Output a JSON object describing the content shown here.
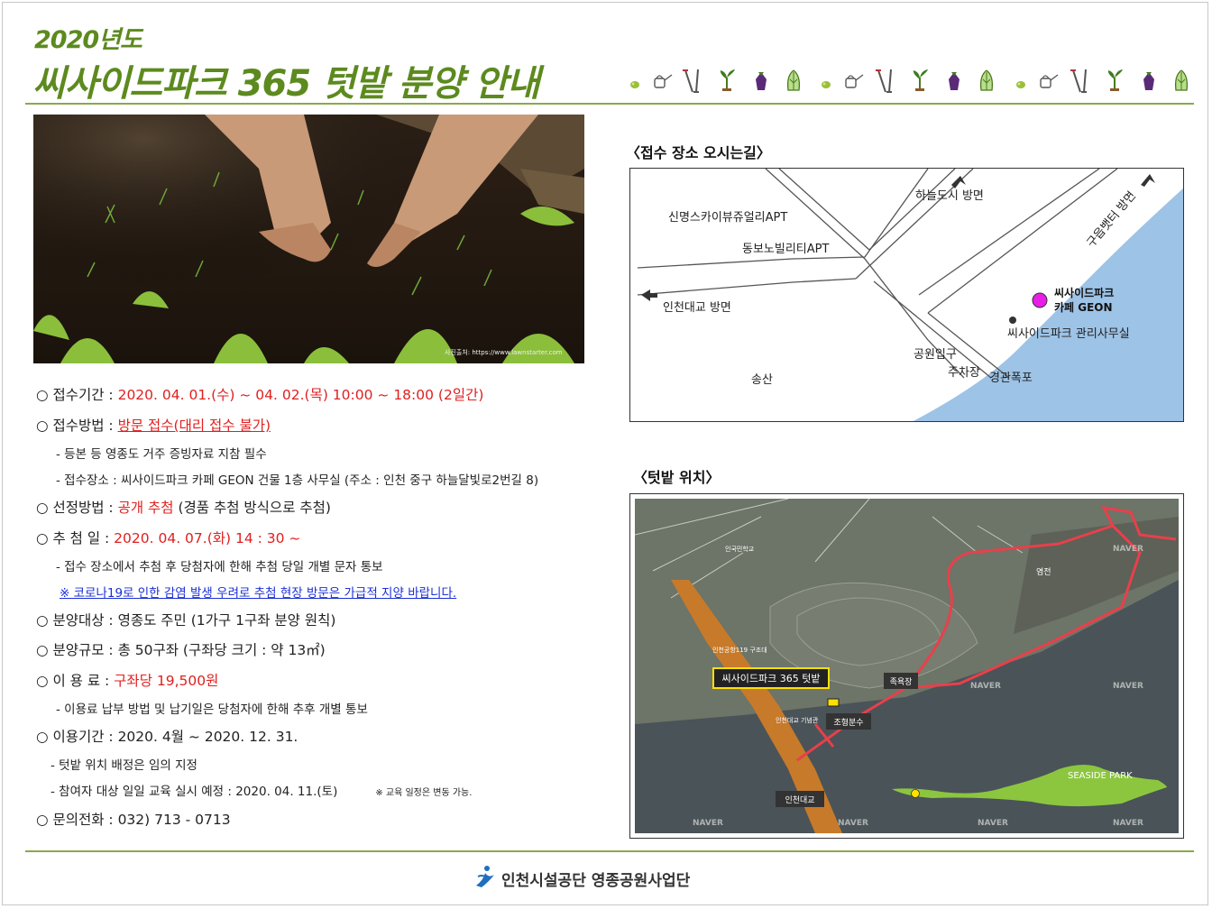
{
  "header": {
    "year": "2020년도",
    "title": "씨사이드파크 365 텃밭 분양 안내"
  },
  "photo": {
    "credit": "사진출처: https://www.lawnstarter.com"
  },
  "icons": [
    "pea-icon",
    "watering-can-icon",
    "garden-tools-icon",
    "seedling-icon",
    "eggplant-icon",
    "cabbage-icon"
  ],
  "info": {
    "period": {
      "label": "○ 접수기간 : ",
      "value": "2020. 04. 01.(수) ~ 04. 02.(목) 10:00 ~ 18:00 (2일간)"
    },
    "method": {
      "label": "○ 접수방법 : ",
      "value": "방문 접수(대리 접수 불가)"
    },
    "method_sub1": "- 등본 등 영종도 거주 증빙자료 지참 필수",
    "method_sub2": "- 접수장소 : 씨사이드파크 카페 GEON 건물 1층 사무실 (주소 : 인천 중구 하늘달빛로2번길 8)",
    "selection": {
      "label": "○ 선정방법 : ",
      "value": "공개 추첨",
      "rest": " (경품 추첨 방식으로 추첨)"
    },
    "draw": {
      "label": "○ 추 첨 일 : ",
      "value": "2020. 04. 07.(화) 14 : 30 ~"
    },
    "draw_sub1": "- 접수 장소에서 추첨 후 당첨자에 한해 추첨 당일 개별 문자 통보",
    "draw_notice": "※ 코로나19로 인한 감염 발생 우려로 추첨 현장 방문은 가급적 지양 바랍니다.",
    "target": "○ 분양대상 : 영종도 주민 (1가구 1구좌 분양 원칙)",
    "scale": "○ 분양규모 : 총 50구좌 (구좌당 크기 : 약 13㎡)",
    "fee": {
      "label": "○ 이 용 료 : ",
      "value": "구좌당 19,500원"
    },
    "fee_sub1": "- 이용료 납부 방법 및 납기일은 당첨자에 한해 추후 개별 통보",
    "usage": "○ 이용기간 : 2020. 4월 ~ 2020. 12. 31.",
    "usage_sub1": "- 텃밭 위치 배정은 임의 지정",
    "usage_sub2": "- 참여자 대상 일일 교육 실시 예정 : 2020. 04. 11.(토)",
    "usage_note": "※ 교육 일정은 변동 가능.",
    "contact": "○ 문의전화 : 032) 713 - 0713"
  },
  "map1": {
    "heading": "〈접수 장소 오시는길〉",
    "labels": {
      "apt1": "신명스카이뷰쥬얼리APT",
      "apt2": "동보노빌리티APT",
      "haneul": "하늘도시 방면",
      "gueup": "구읍뱃터 방면",
      "incheon": "인천대교 방면",
      "cafe1": "씨사이드파크",
      "cafe2": "카페 GEON",
      "office": "씨사이드파크 관리사무실",
      "entrance": "공원입구",
      "parking": "주차장",
      "waterfall": "경관폭포",
      "songsan": "송산"
    },
    "colors": {
      "sea": "#9dc3e6",
      "cafe_marker": "#e81ee8"
    }
  },
  "map2": {
    "heading": "〈텃밭 위치〉",
    "labels": {
      "garden": "씨사이드파크 365 텃밭",
      "salt": "염전",
      "footvolley": "족욕장",
      "fountain": "조형분수",
      "bridge": "인천대교",
      "seaside": "SEASIDE PARK",
      "firestation": "인천공항119 구조대",
      "memorial": "인천대교 기념관",
      "school": "인국민학교",
      "naver": "NAVER"
    },
    "colors": {
      "route": "#e8404a",
      "park": "#8cc63f",
      "label_border": "#ffe000"
    }
  },
  "footer": {
    "org": "인천시설공단 영종공원사업단"
  }
}
